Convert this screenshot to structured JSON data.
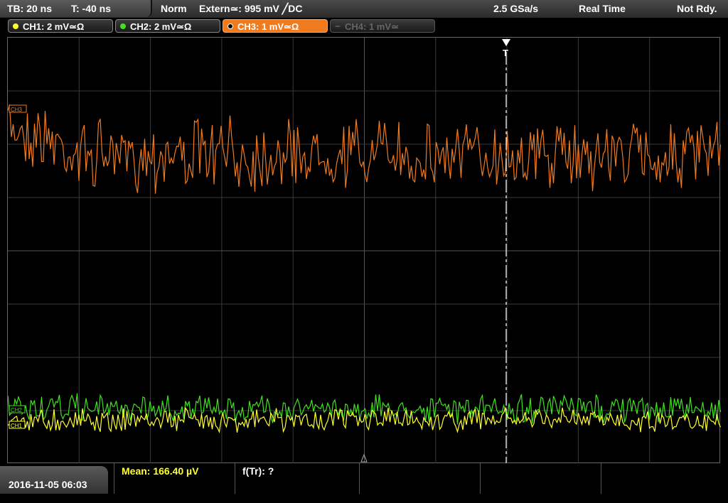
{
  "header": {
    "timebase": "TB: 20 ns",
    "trigger_offset": "T: -40 ns",
    "mode": "Norm",
    "trigger_source": "Extern≃: 995 mV ╱DC",
    "sample_rate": "2.5 GSa/s",
    "acq_mode": "Real Time",
    "status": "Not Rdy."
  },
  "channels": [
    {
      "label": "CH1: 2 mV≃Ω",
      "color": "#ffff30",
      "state": "on"
    },
    {
      "label": "CH2: 2 mV≃Ω",
      "color": "#40e020",
      "state": "on"
    },
    {
      "label": "CH3: 1 mV≃Ω",
      "color": "#f07a1e",
      "state": "active"
    },
    {
      "label": "CH4: 1 mV≃",
      "color": "#666666",
      "state": "off"
    }
  ],
  "markers": {
    "ch3": "CH3",
    "ch2": "CH2",
    "ch1": "CH1",
    "trigger": "T"
  },
  "footer": {
    "datetime": "2016-11-05 06:03",
    "mean": "Mean: 166.40 µV",
    "ftr": "f(Tr): ?"
  },
  "colors": {
    "ch1": "#ffff30",
    "ch2": "#40e020",
    "ch3": "#f07a1e",
    "grid": "#3a3a3a"
  }
}
